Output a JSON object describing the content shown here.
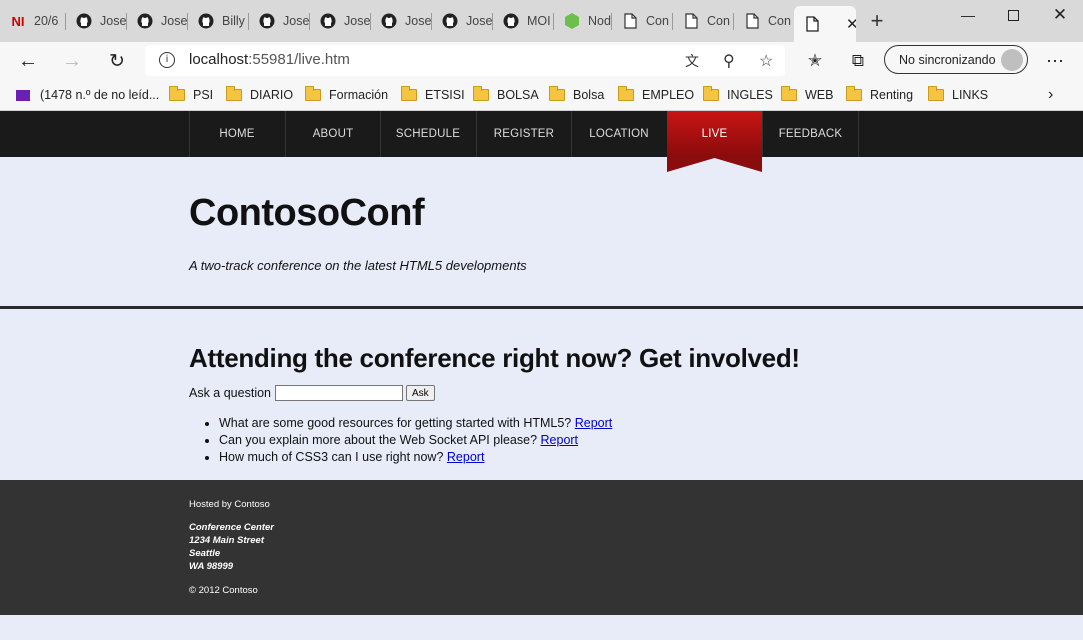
{
  "browser": {
    "tabs": [
      {
        "icon": "ni-icon",
        "label": "20/6"
      },
      {
        "icon": "github-icon",
        "label": "Jose"
      },
      {
        "icon": "github-icon",
        "label": "Jose"
      },
      {
        "icon": "github-icon",
        "label": "Billy"
      },
      {
        "icon": "github-icon",
        "label": "Jose"
      },
      {
        "icon": "github-icon",
        "label": "Jose"
      },
      {
        "icon": "github-icon",
        "label": "Jose"
      },
      {
        "icon": "github-icon",
        "label": "Jose"
      },
      {
        "icon": "github-icon",
        "label": "MOI"
      },
      {
        "icon": "nodejs-icon",
        "label": "Nod"
      },
      {
        "icon": "page-icon",
        "label": "Con"
      },
      {
        "icon": "page-icon",
        "label": "Con"
      },
      {
        "icon": "page-icon",
        "label": "Con"
      }
    ],
    "active_tab_close": "✕",
    "new_tab": "+",
    "url_host": "localhost",
    "url_rest": ":55981/live.htm",
    "profile_label": "No sincronizando",
    "bookmarks": [
      {
        "type": "mail",
        "label": "(1478 n.º de no leíd..."
      },
      {
        "type": "folder",
        "label": "PSI"
      },
      {
        "type": "folder",
        "label": "DIARIO"
      },
      {
        "type": "folder",
        "label": "Formación"
      },
      {
        "type": "folder",
        "label": "ETSISI"
      },
      {
        "type": "folder",
        "label": "BOLSA"
      },
      {
        "type": "folder",
        "label": "Bolsa"
      },
      {
        "type": "folder",
        "label": "EMPLEO"
      },
      {
        "type": "folder",
        "label": "INGLES"
      },
      {
        "type": "folder",
        "label": "WEB"
      },
      {
        "type": "folder",
        "label": "Renting"
      },
      {
        "type": "folder",
        "label": "LINKS"
      }
    ]
  },
  "site": {
    "nav": [
      "HOME",
      "ABOUT",
      "SCHEDULE",
      "REGISTER",
      "LOCATION",
      "LIVE",
      "FEEDBACK"
    ],
    "active_nav": "LIVE",
    "title": "ContosoConf",
    "tagline": "A two-track conference on the latest HTML5 developments",
    "section_heading": "Attending the conference right now? Get involved!",
    "ask_label": "Ask a question",
    "ask_input_value": "",
    "ask_button": "Ask",
    "questions": [
      {
        "text": "What are some good resources for getting started with HTML5?",
        "link": "Report"
      },
      {
        "text": "Can you explain more about the Web Socket API please?",
        "link": "Report"
      },
      {
        "text": "How much of CSS3 can I use right now?",
        "link": "Report"
      }
    ],
    "footer": {
      "hosted": "Hosted by Contoso",
      "address": [
        "Conference Center",
        "1234 Main Street",
        "Seattle",
        "WA 98999"
      ],
      "copyright": "© 2012 Contoso"
    },
    "colors": {
      "nav_bg": "#1a1a1a",
      "live_accent": "#a10f0f",
      "page_bg": "#e8ecf9",
      "footer_bg": "#333333"
    }
  }
}
